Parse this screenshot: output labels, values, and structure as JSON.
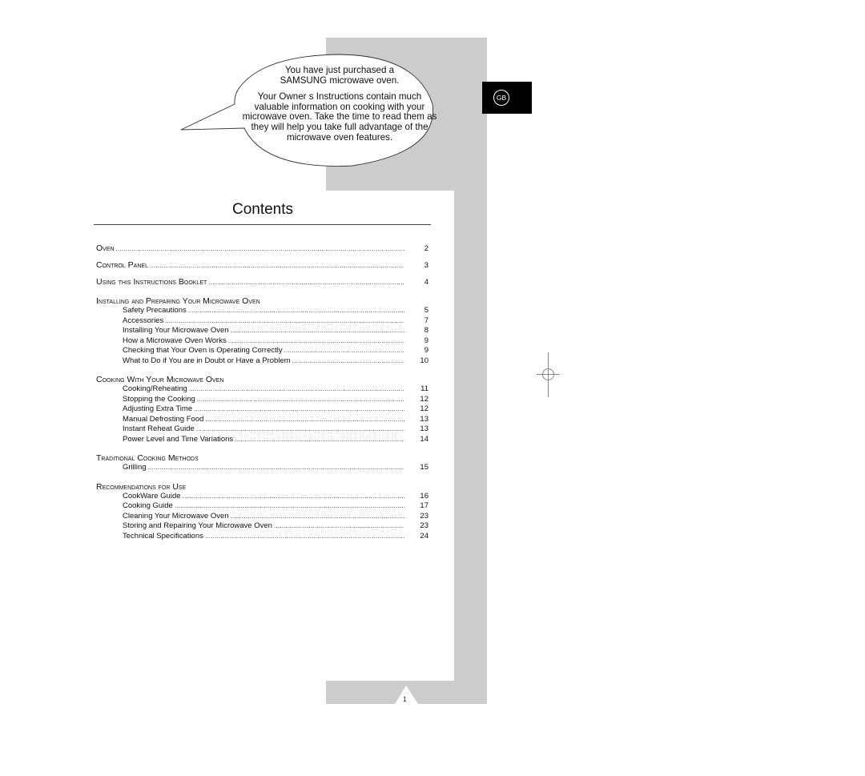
{
  "callout": {
    "line1": "You have just purchased a",
    "line2": "SAMSUNG microwave oven.",
    "paragraph": "Your Owner s Instructions contain much valuable information on cooking with your microwave oven. Take the time to read them as they will help you take full advantage of the microwave oven features."
  },
  "language_tab": {
    "label": "GB"
  },
  "contents": {
    "title": "Contents",
    "top_entries": [
      {
        "label": "Oven",
        "page": "2"
      },
      {
        "label": "Control Panel",
        "page": "3"
      },
      {
        "label": "Using this Instructions Booklet",
        "page": "4"
      }
    ],
    "sections": [
      {
        "heading": "Installing and Preparing Your Microwave Oven",
        "items": [
          {
            "label": "Safety Precautions",
            "page": "5"
          },
          {
            "label": "Accessories",
            "page": "7"
          },
          {
            "label": "Installing Your Microwave Oven",
            "page": "8"
          },
          {
            "label": "How a Microwave Oven Works",
            "page": "9"
          },
          {
            "label": "Checking that Your Oven is Operating Correctly",
            "page": "9"
          },
          {
            "label": "What to Do if You are in Doubt or Have a Problem",
            "page": "10"
          }
        ]
      },
      {
        "heading": "Cooking With Your Microwave Oven",
        "items": [
          {
            "label": "Cooking/Reheating",
            "page": "11"
          },
          {
            "label": "Stopping the Cooking",
            "page": "12"
          },
          {
            "label": "Adjusting Extra Time",
            "page": "12"
          },
          {
            "label": "Manual Defrosting Food",
            "page": "13"
          },
          {
            "label": "Instant Reheat Guide",
            "page": "13"
          },
          {
            "label": "Power Level and Time Variations",
            "page": "14"
          }
        ]
      },
      {
        "heading": "Traditional Cooking Methods",
        "items": [
          {
            "label": "Grilling",
            "page": "15"
          }
        ]
      },
      {
        "heading": "Recommendations for Use",
        "items": [
          {
            "label": "CookWare Guide",
            "page": "16"
          },
          {
            "label": "Cooking Guide",
            "page": "17"
          },
          {
            "label": "Cleaning Your Microwave Oven",
            "page": "23"
          },
          {
            "label": "Storing and Repairing Your Microwave Oven",
            "page": "23"
          },
          {
            "label": "Technical Specifications",
            "page": "24"
          }
        ]
      }
    ]
  },
  "footer": {
    "page_number": "1"
  }
}
